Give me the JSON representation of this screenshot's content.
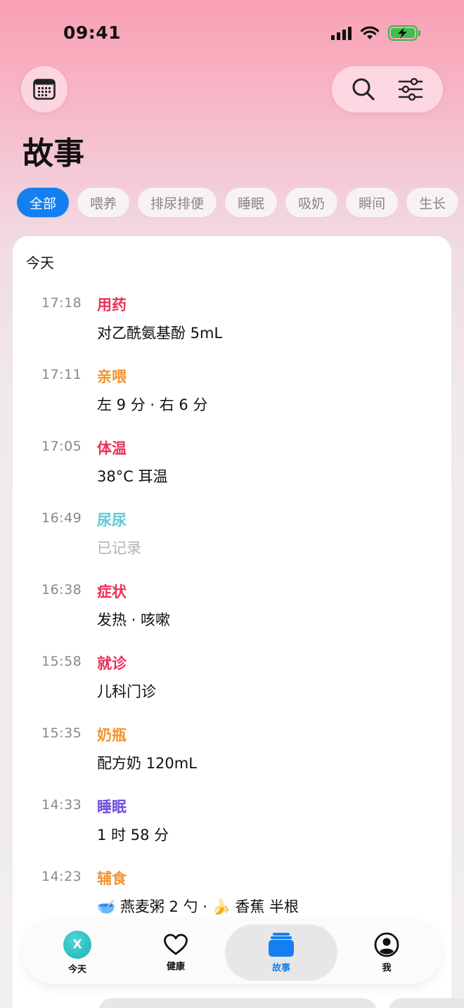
{
  "status_bar": {
    "time": "09:41"
  },
  "header": {
    "title": "故事"
  },
  "filters": [
    {
      "label": "全部",
      "active": true
    },
    {
      "label": "喂养",
      "active": false
    },
    {
      "label": "排尿排便",
      "active": false
    },
    {
      "label": "睡眠",
      "active": false
    },
    {
      "label": "吸奶",
      "active": false
    },
    {
      "label": "瞬间",
      "active": false
    },
    {
      "label": "生长",
      "active": false
    }
  ],
  "timeline": {
    "day_label": "今天",
    "entries": [
      {
        "time": "17:18",
        "type": "用药",
        "color": "#e8325a",
        "detail": "对乙酰氨基酚 5mL",
        "muted": false
      },
      {
        "time": "17:11",
        "type": "亲喂",
        "color": "#f5932a",
        "detail": "左 9 分 · 右 6 分",
        "muted": false
      },
      {
        "time": "17:05",
        "type": "体温",
        "color": "#e8325a",
        "detail": "38°C 耳温",
        "muted": false
      },
      {
        "time": "16:49",
        "type": "尿尿",
        "color": "#5fc9d8",
        "detail": "已记录",
        "muted": true
      },
      {
        "time": "16:38",
        "type": "症状",
        "color": "#e8325a",
        "detail": "发热 · 咳嗽",
        "muted": false
      },
      {
        "time": "15:58",
        "type": "就诊",
        "color": "#e8325a",
        "detail": "儿科门诊",
        "muted": false
      },
      {
        "time": "15:35",
        "type": "奶瓶",
        "color": "#f5932a",
        "detail": "配方奶 120mL",
        "muted": false
      },
      {
        "time": "14:33",
        "type": "睡眠",
        "color": "#6b4fd8",
        "detail": "1 时 58 分",
        "muted": false
      },
      {
        "time": "14:23",
        "type": "辅食",
        "color": "#f5932a",
        "detail": "🥣 燕麦粥 2 勺 · 🍌 香蕉 半根",
        "muted": false
      }
    ]
  },
  "tabbar": {
    "items": [
      {
        "label": "今天",
        "icon": "today-badge-icon",
        "badge": "X"
      },
      {
        "label": "健康",
        "icon": "heart-icon"
      },
      {
        "label": "故事",
        "icon": "stack-icon",
        "active": true
      },
      {
        "label": "我",
        "icon": "profile-icon"
      }
    ]
  },
  "colors": {
    "accent": "#1480f0",
    "brand_pink": "#f9a0b4"
  }
}
